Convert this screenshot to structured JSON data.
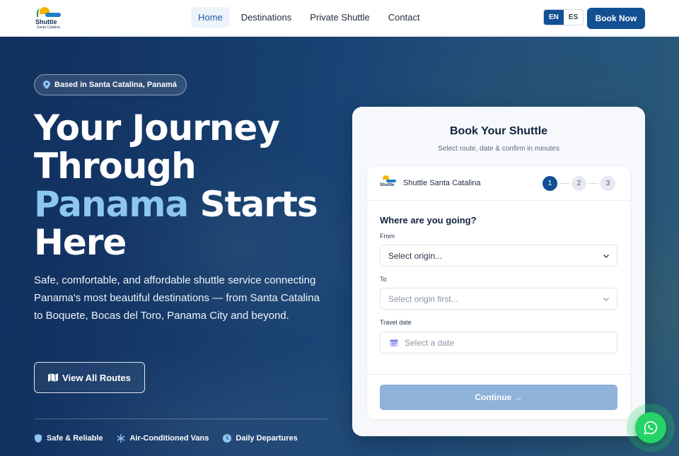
{
  "brand": {
    "logo_text": "Shuttle",
    "logo_sub": "Santa Catalina"
  },
  "nav": [
    {
      "label": "Home",
      "active": true
    },
    {
      "label": "Destinations"
    },
    {
      "label": "Private Shuttle"
    },
    {
      "label": "Contact"
    }
  ],
  "lang": {
    "en": "EN",
    "es": "ES",
    "selected": "EN"
  },
  "header": {
    "book_now": "Book Now"
  },
  "hero": {
    "badge": "Based in Santa Catalina, Panamá",
    "title_1": "Your Journey",
    "title_2": "Through",
    "title_highlight": "Panama",
    "title_3": "Starts",
    "title_4": "Here",
    "description": "Safe, comfortable, and affordable shuttle service connecting Panama's most beautiful destinations — from Santa Catalina to Boquete, Bocas del Toro, Panama City and beyond.",
    "routes_button": "View All Routes",
    "features": [
      {
        "label": "Safe & Reliable",
        "icon": "shield-icon"
      },
      {
        "label": "Air-Conditioned Vans",
        "icon": "snowflake-icon"
      },
      {
        "label": "Daily Departures",
        "icon": "clock-icon"
      }
    ]
  },
  "booking": {
    "title": "Book Your Shuttle",
    "subtitle": "Select route, date & confirm in minutes",
    "brand": "Shuttle Santa Catalina",
    "steps": [
      "1",
      "2",
      "3"
    ],
    "active_step": 1,
    "question": "Where are you going?",
    "from_label": "From",
    "from_placeholder": "Select origin...",
    "to_label": "To",
    "to_placeholder": "Select origin first...",
    "date_label": "Travel date",
    "date_placeholder": "Select a date",
    "continue": "Continue →"
  },
  "colors": {
    "primary": "#124f93",
    "highlight": "#8ec6f2",
    "whatsapp": "#25d366",
    "continue_disabled": "#8fb3da"
  }
}
